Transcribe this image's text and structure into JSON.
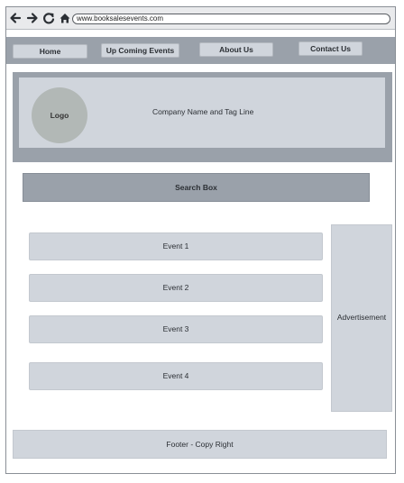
{
  "browser": {
    "url": "www.booksalesevents.com",
    "icons": [
      "back-arrow-icon",
      "forward-arrow-icon",
      "refresh-icon",
      "home-icon"
    ]
  },
  "nav": {
    "items": [
      {
        "label": "Home"
      },
      {
        "label": "Up Coming Events"
      },
      {
        "label": "About Us"
      },
      {
        "label": "Contact Us"
      }
    ]
  },
  "header": {
    "logo": "Logo",
    "tagline": "Company Name and Tag Line"
  },
  "search": {
    "label": "Search Box"
  },
  "events": [
    {
      "label": "Event 1"
    },
    {
      "label": "Event 2"
    },
    {
      "label": "Event 3"
    },
    {
      "label": "Event 4"
    }
  ],
  "sidebar": {
    "advertisement": "Advertisement"
  },
  "footer": {
    "text": "Footer - Copy Right"
  },
  "colors": {
    "nav_bar": "#9aa1aa",
    "panel": "#d0d5dc",
    "logo_circle": "#b2b8b6",
    "text": "#2b2f34"
  }
}
